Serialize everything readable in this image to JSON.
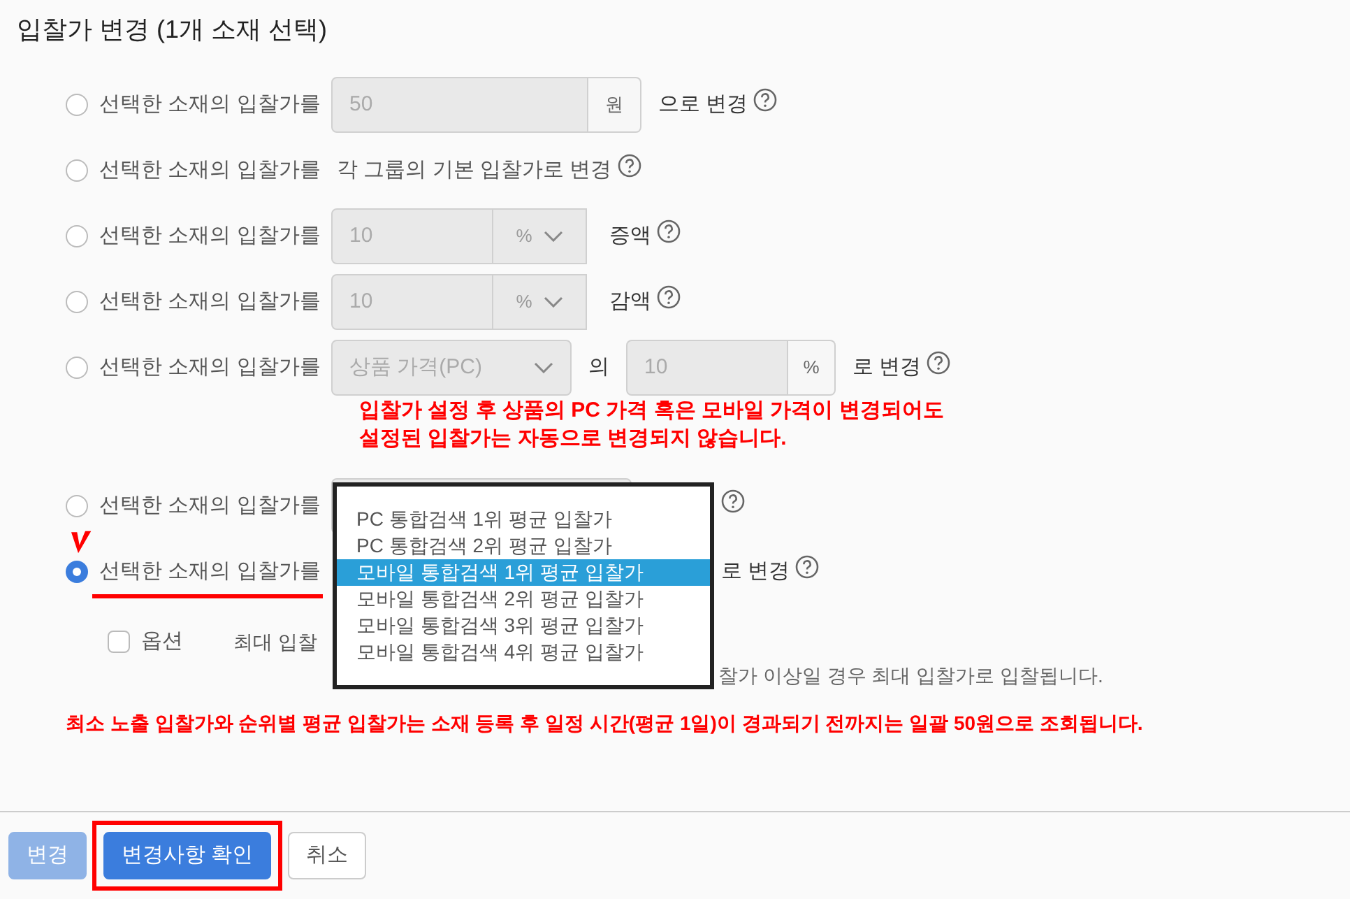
{
  "title": "입찰가 변경 (1개 소재 선택)",
  "options": [
    {
      "kind": "amount",
      "selected": false,
      "label": "선택한 소재의 입찰가를",
      "value": "50",
      "unit": "원",
      "suffix": "으로 변경"
    },
    {
      "kind": "text",
      "selected": false,
      "label": "선택한 소재의 입찰가를",
      "suffix": "각 그룹의 기본 입찰가로 변경"
    },
    {
      "kind": "percent",
      "selected": false,
      "label": "선택한 소재의 입찰가를",
      "value": "10",
      "unit": "%",
      "suffix": "증액"
    },
    {
      "kind": "percent",
      "selected": false,
      "label": "선택한 소재의 입찰가를",
      "value": "10",
      "unit": "%",
      "suffix": "감액"
    },
    {
      "kind": "ratio",
      "selected": false,
      "label": "선택한 소재의 입찰가를",
      "select": "상품 가격(PC)",
      "connector": "의",
      "value": "10",
      "unit": "%",
      "suffix": "로 변경",
      "note": [
        "입찰가 설정 후 상품의 PC 가격 혹은 모바일 가격이 변경되어도",
        "설정된 입찰가는 자동으로 변경되지 않습니다."
      ]
    },
    {
      "kind": "covered",
      "selected": false,
      "label": "선택한 소재의 입찰가를"
    },
    {
      "kind": "rank",
      "selected": true,
      "label": "선택한 소재의 입찰가를",
      "suffix": "로 변경"
    }
  ],
  "dropdown": [
    {
      "label": "PC 통합검색 1위 평균 입찰가",
      "selected": false
    },
    {
      "label": "PC 통합검색 2위 평균 입찰가",
      "selected": false
    },
    {
      "label": "모바일 통합검색 1위 평균 입찰가",
      "selected": true
    },
    {
      "label": "모바일 통합검색 2위 평균 입찰가",
      "selected": false
    },
    {
      "label": "모바일 통합검색 3위 평균 입찰가",
      "selected": false
    },
    {
      "label": "모바일 통합검색 4위 평균 입찰가",
      "selected": false
    }
  ],
  "option_row": {
    "checked": false,
    "label": "옵션",
    "max_label": "최대 입찰",
    "note": "찰가 이상일 경우 최대 입찰가로 입찰됩니다."
  },
  "warning": "최소 노출 입찰가와 순위별 평균 입찰가는 소재 등록 후 일정 시간(평균 1일)이 경과되기 전까지는 일괄 50원으로 조회됩니다.",
  "buttons": [
    {
      "kind": "disabled",
      "label": "변경"
    },
    {
      "kind": "primary",
      "label": "변경사항 확인"
    },
    {
      "kind": "default",
      "label": "취소"
    }
  ]
}
